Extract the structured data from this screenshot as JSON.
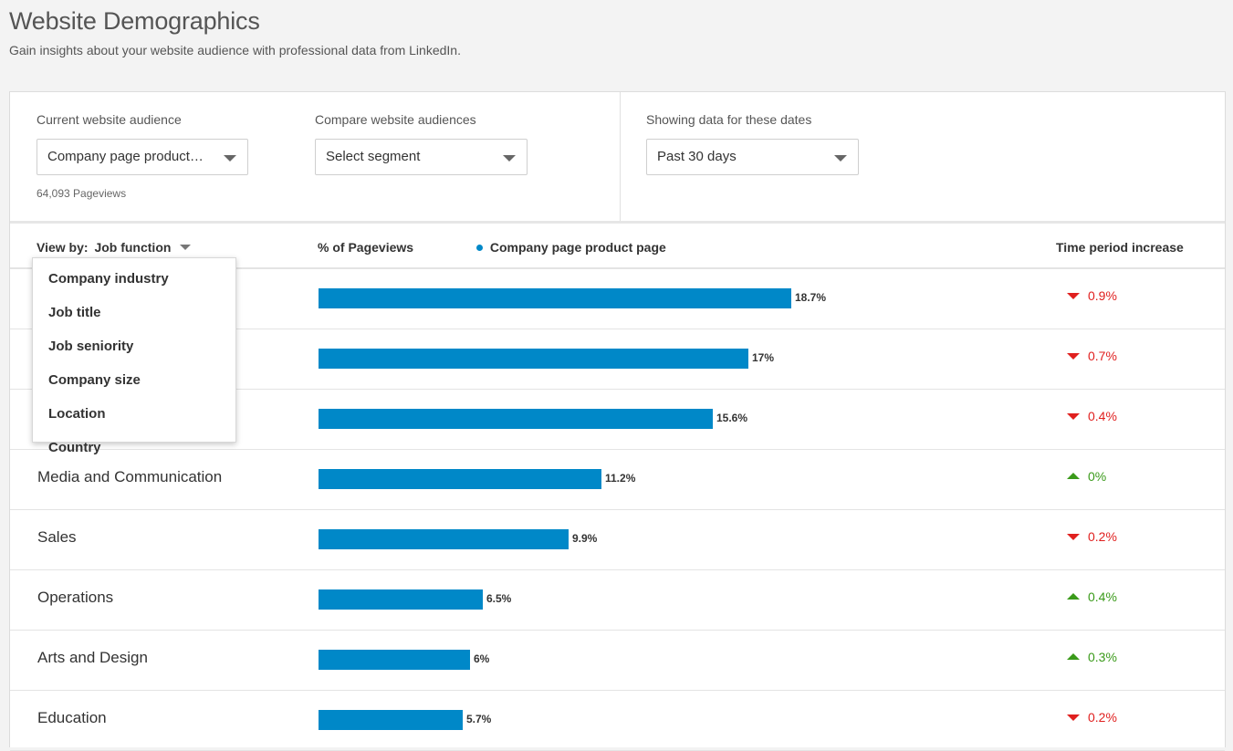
{
  "header": {
    "title": "Website Demographics",
    "subtitle": "Gain insights about your website audience with professional data from LinkedIn."
  },
  "filters": {
    "current": {
      "label": "Current website audience",
      "value": "Company page product…",
      "pageviews": "64,093 Pageviews"
    },
    "compare": {
      "label": "Compare website audiences",
      "value": "Select segment"
    },
    "dates": {
      "label": "Showing data for these dates",
      "value": "Past 30 days"
    }
  },
  "table_header": {
    "view_by_prefix": "View by:",
    "view_by_value": "Job function",
    "pct_label": "% of Pageviews",
    "legend": "Company page product page",
    "increase_label": "Time period increase"
  },
  "dropdown": {
    "items": [
      "Company industry",
      "Job title",
      "Job seniority",
      "Company size",
      "Location",
      "Country"
    ]
  },
  "rows": [
    {
      "label": "",
      "percent": 18.7,
      "value_text": "18.7%",
      "delta_text": "0.9%",
      "direction": "down"
    },
    {
      "label": "",
      "percent": 17,
      "value_text": "17%",
      "delta_text": "0.7%",
      "direction": "down"
    },
    {
      "label": "",
      "percent": 15.6,
      "value_text": "15.6%",
      "delta_text": "0.4%",
      "direction": "down"
    },
    {
      "label": "Media and Communication",
      "percent": 11.2,
      "value_text": "11.2%",
      "delta_text": "0%",
      "direction": "up"
    },
    {
      "label": "Sales",
      "percent": 9.9,
      "value_text": "9.9%",
      "delta_text": "0.2%",
      "direction": "down"
    },
    {
      "label": "Operations",
      "percent": 6.5,
      "value_text": "6.5%",
      "delta_text": "0.4%",
      "direction": "up"
    },
    {
      "label": "Arts and Design",
      "percent": 6,
      "value_text": "6%",
      "delta_text": "0.3%",
      "direction": "up"
    },
    {
      "label": "Education",
      "percent": 5.7,
      "value_text": "5.7%",
      "delta_text": "0.2%",
      "direction": "down"
    }
  ],
  "colors": {
    "bar": "#0088c8",
    "down": "#e0201f",
    "up": "#3a9a1a"
  }
}
